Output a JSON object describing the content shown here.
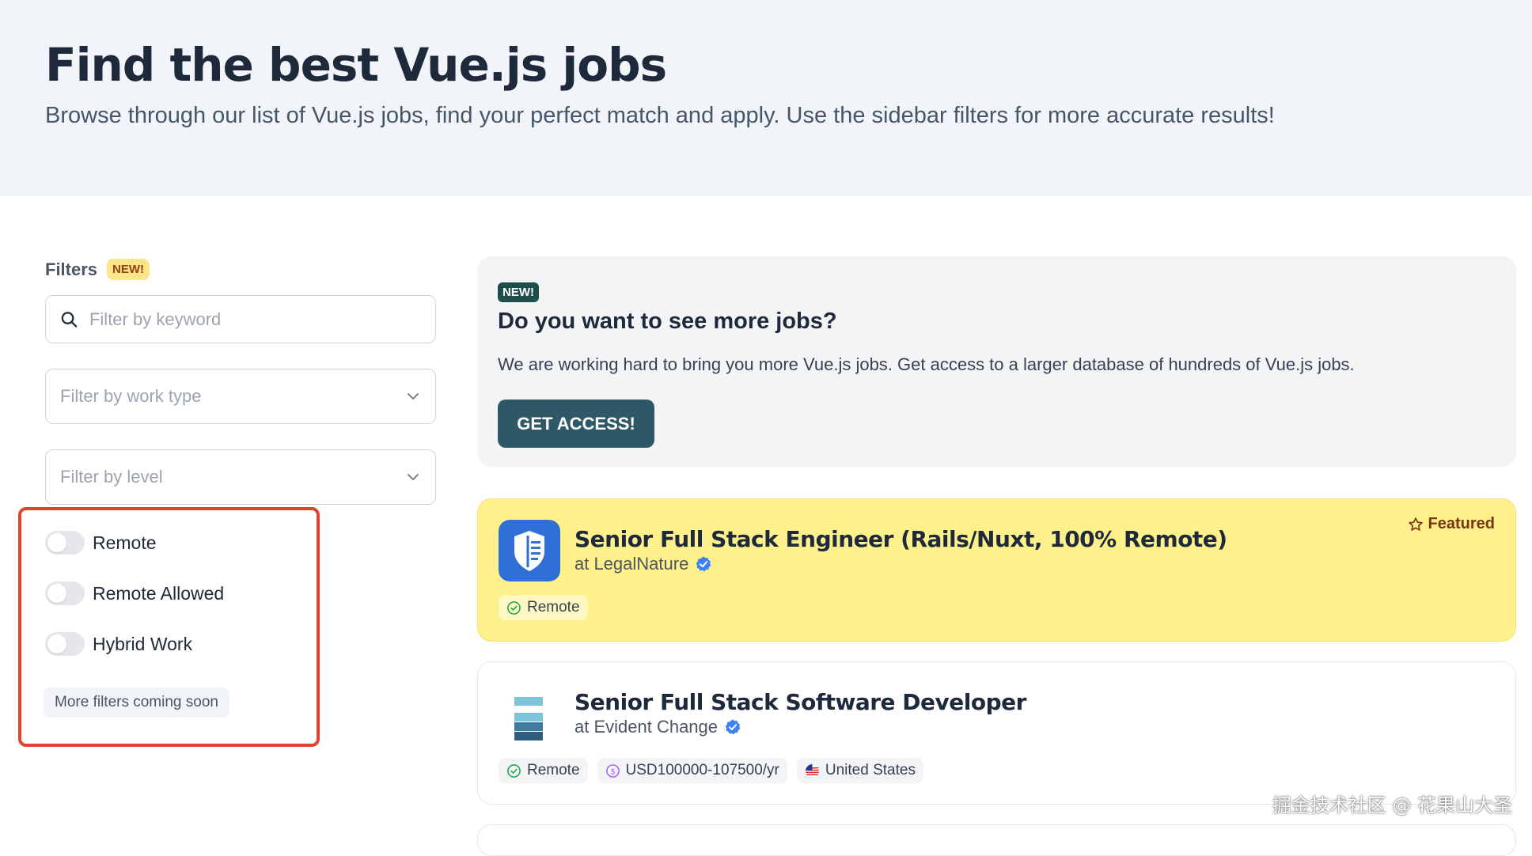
{
  "hero": {
    "title": "Find the best Vue.js jobs",
    "subtitle": "Browse through our list of Vue.js jobs, find your perfect match and apply. Use the sidebar filters for more accurate results!"
  },
  "sidebar": {
    "filters_label": "Filters",
    "new_badge": "NEW!",
    "keyword_placeholder": "Filter by keyword",
    "work_type_placeholder": "Filter by work type",
    "level_placeholder": "Filter by level",
    "toggles": [
      {
        "label": "Remote",
        "checked": false
      },
      {
        "label": "Remote Allowed",
        "checked": false
      },
      {
        "label": "Hybrid Work",
        "checked": false
      }
    ],
    "more_filters": "More filters coming soon"
  },
  "promo": {
    "badge": "NEW!",
    "heading": "Do you want to see more jobs?",
    "text": "We are working hard to bring you more Vue.js jobs. Get access to a larger database of hundreds of Vue.js jobs.",
    "button": "GET ACCESS!"
  },
  "jobs": [
    {
      "title": "Senior Full Stack Engineer (Rails/Nuxt, 100% Remote)",
      "company": "at LegalNature",
      "featured_label": "Featured",
      "chips": [
        "Remote"
      ]
    },
    {
      "title": "Senior Full Stack Software Developer",
      "company": "at Evident Change",
      "chips": [
        "Remote",
        "USD100000-107500/yr",
        "United States"
      ]
    }
  ],
  "watermark": "掘金技术社区 @ 花果山大圣",
  "colors": {
    "accent_button": "#2f5866",
    "featured_bg": "#fef08a",
    "highlight_border": "#e0432e",
    "verified": "#3b82f6"
  }
}
